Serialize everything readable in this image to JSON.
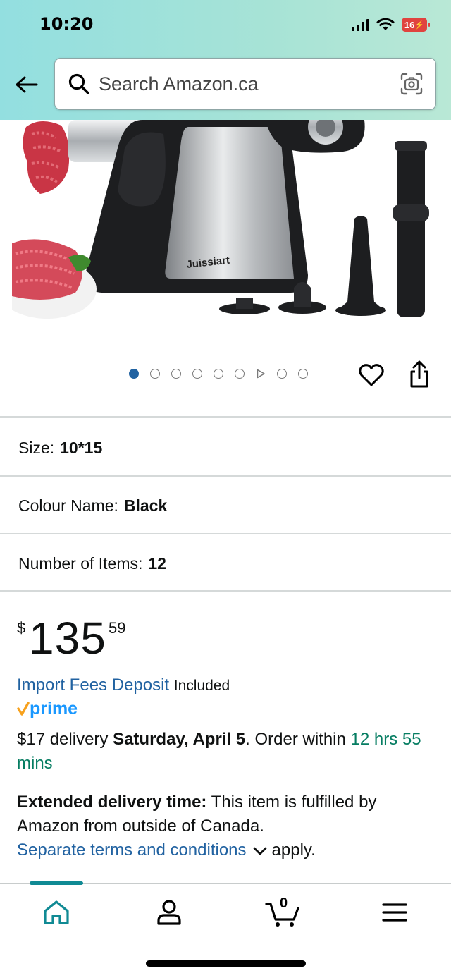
{
  "status_bar": {
    "time": "10:20",
    "battery": "16"
  },
  "search": {
    "placeholder": "Search Amazon.ca"
  },
  "product_image": {
    "brand_text": "Juissiart"
  },
  "carousel": {
    "count": 9,
    "active_index": 0,
    "video_index": 6
  },
  "variations": {
    "size_label": "Size:",
    "size_value": "10*15",
    "colour_label": "Colour Name:",
    "colour_value": "Black",
    "items_label": "Number of Items:",
    "items_value": "12"
  },
  "price": {
    "currency": "$",
    "whole": "135",
    "fraction": "59"
  },
  "import_fees": {
    "link": "Import Fees Deposit",
    "status": "Included"
  },
  "prime_label": "prime",
  "delivery": {
    "fee": "$17 delivery ",
    "date": "Saturday, April 5",
    "order_within": ". Order within ",
    "countdown": "12 hrs 55 mins"
  },
  "extended": {
    "title": "Extended delivery time:",
    "text": " This item is fulfilled by Amazon from outside of Canada.",
    "terms_link": "Separate terms and conditions",
    "apply": "apply."
  },
  "bottom_nav": {
    "cart_count": "0"
  },
  "colors": {
    "link": "#2162a1",
    "green": "#067d62",
    "teal": "#108a94",
    "header_start": "#93dfe0",
    "header_end": "#b9e8d6"
  }
}
